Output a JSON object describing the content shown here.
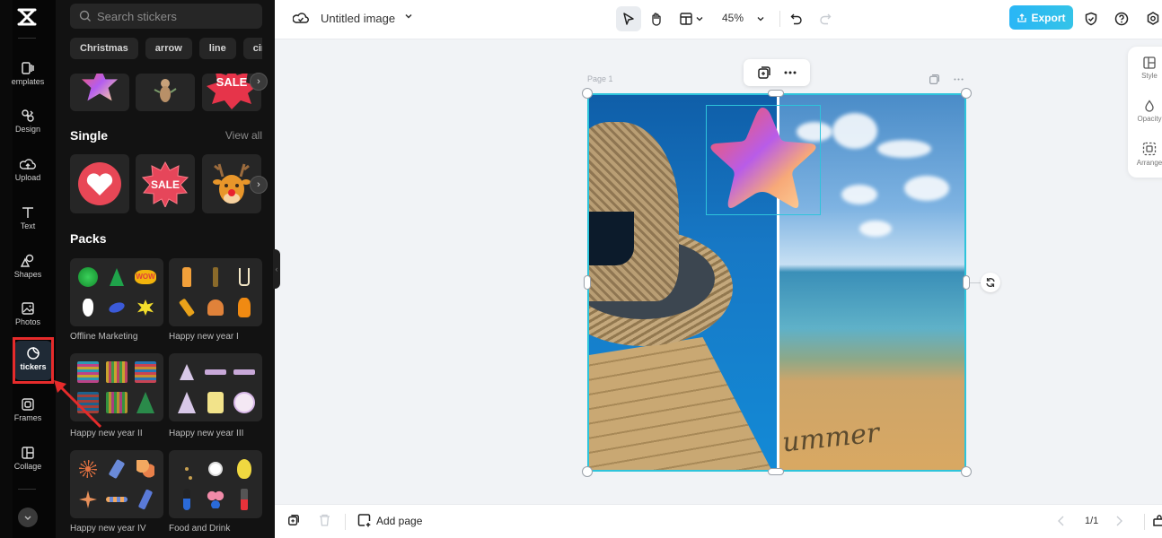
{
  "rail": {
    "items": [
      {
        "label": "emplates",
        "icon": "templates-icon"
      },
      {
        "label": "Design",
        "icon": "design-icon"
      },
      {
        "label": "Upload",
        "icon": "upload-icon"
      },
      {
        "label": "Text",
        "icon": "text-icon"
      },
      {
        "label": "Shapes",
        "icon": "shapes-icon"
      },
      {
        "label": "Photos",
        "icon": "photos-icon"
      },
      {
        "label": "tickers",
        "icon": "stickers-icon",
        "active": true
      },
      {
        "label": "Frames",
        "icon": "frames-icon"
      },
      {
        "label": "Collage",
        "icon": "collage-icon"
      }
    ]
  },
  "panel": {
    "search_placeholder": "Search stickers",
    "chips": [
      "Christmas",
      "arrow",
      "line",
      "circ"
    ],
    "top_row": [
      "star-sticker",
      "cherub-sticker",
      "sale-sticker"
    ],
    "single": {
      "title": "Single",
      "view_all": "View all",
      "items": [
        "heart-sticker",
        "sale-badge-sticker",
        "reindeer-sticker"
      ],
      "sale_text": "SALE"
    },
    "packs": {
      "title": "Packs",
      "items": [
        {
          "name": "Offline Marketing"
        },
        {
          "name": "Happy new year I"
        },
        {
          "name": "Happy new year II"
        },
        {
          "name": "Happy new year III"
        },
        {
          "name": "Happy new year IV"
        },
        {
          "name": "Food and Drink"
        }
      ]
    }
  },
  "topbar": {
    "title": "Untitled image",
    "zoom": "45%",
    "export_label": "Export",
    "export_color": "#29b6f6"
  },
  "right_panel": {
    "items": [
      {
        "label": "Style"
      },
      {
        "label": "Opacity"
      },
      {
        "label": "Arrange"
      }
    ]
  },
  "canvas": {
    "page_label": "Page 1",
    "sand_text": "ummer",
    "selection_color": "#2ec4db"
  },
  "bottombar": {
    "add_page": "Add page",
    "page_counter": "1/1"
  },
  "annotation": {
    "highlight_color": "#e62b2b"
  }
}
